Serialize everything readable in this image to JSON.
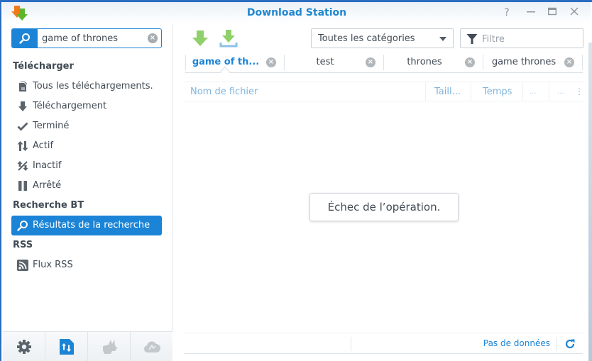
{
  "window": {
    "title": "Download Station",
    "controls": {
      "help": "?",
      "minimize": "–",
      "maximize": "□",
      "close": "×"
    }
  },
  "sidebar": {
    "search": {
      "value": "game of thrones",
      "icon": "search-icon",
      "clear_icon": "clear-icon"
    },
    "sections": [
      {
        "title": "Télécharger",
        "items": [
          {
            "label": "Tous les téléchargements.",
            "icon": "all-downloads-icon"
          },
          {
            "label": "Téléchargement",
            "icon": "download-arrow-icon"
          },
          {
            "label": "Terminé",
            "icon": "checkmark-icon"
          },
          {
            "label": "Actif",
            "icon": "up-down-arrows-icon"
          },
          {
            "label": "Inactif",
            "icon": "inactive-arrows-icon"
          },
          {
            "label": "Arrêté",
            "icon": "pause-icon"
          }
        ]
      },
      {
        "title": "Recherche BT",
        "items": [
          {
            "label": "Résultats de la recherche",
            "icon": "search-icon",
            "active": true
          }
        ]
      },
      {
        "title": "RSS",
        "items": [
          {
            "label": "Flux RSS",
            "icon": "rss-icon"
          }
        ]
      }
    ],
    "footer": [
      {
        "name": "settings",
        "icon": "gear-icon"
      },
      {
        "name": "transfer",
        "icon": "transfer-file-icon",
        "active": true
      },
      {
        "name": "emule",
        "icon": "donkey-icon"
      },
      {
        "name": "cloud",
        "icon": "cloud-icon"
      }
    ]
  },
  "toolbar": {
    "download_icon": "download-icon",
    "download_to_icon": "download-tray-icon",
    "category_select": {
      "selected": "Toutes les catégories"
    },
    "filter": {
      "placeholder": "Filtre",
      "value": ""
    }
  },
  "tabs": [
    {
      "label": "game of th...",
      "active": true
    },
    {
      "label": "test"
    },
    {
      "label": "thrones"
    },
    {
      "label": "game thrones"
    }
  ],
  "grid": {
    "columns": [
      "Nom de fichier",
      "Taill...",
      "Temps",
      "...",
      "...",
      "⋮"
    ]
  },
  "message": "Échec de l’opération.",
  "status": {
    "text": "Pas de données"
  },
  "colors": {
    "accent": "#1b84d6",
    "title": "#1f87cf",
    "header_text": "#7fb5de",
    "download_green": "#8fd06a"
  }
}
